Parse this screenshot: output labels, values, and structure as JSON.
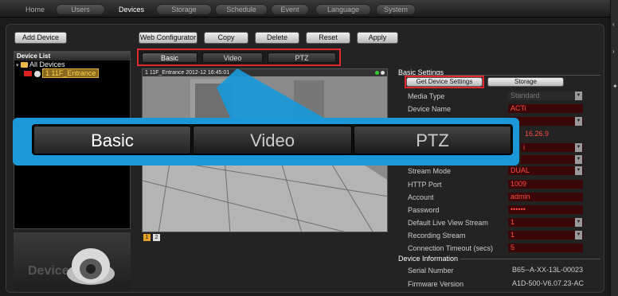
{
  "nav": {
    "tabs": [
      "Home",
      "Users",
      "Devices",
      "Storage",
      "Schedule",
      "Event",
      "Language",
      "System"
    ],
    "active": "Devices"
  },
  "toolbar": {
    "add_device": "Add Device",
    "web_configurator": "Web Configurator",
    "copy": "Copy",
    "delete": "Delete",
    "reset": "Reset",
    "apply": "Apply"
  },
  "device_list": {
    "header": "Device List",
    "root": "All Devices",
    "item": "1 11F_Entrance"
  },
  "brand": {
    "word": "Device"
  },
  "subtabs": [
    "Basic",
    "Video",
    "PTZ"
  ],
  "video": {
    "overlay": "1 11F_Entrance  2012-12 16:45:01",
    "icon_1": "1",
    "icon_2": "2"
  },
  "callout": {
    "tabs": [
      "Basic",
      "Video",
      "PTZ"
    ]
  },
  "settings": {
    "title": "Basic Settings",
    "get_device_settings": "Get Device Settings",
    "storage": "Storage",
    "rows": [
      {
        "label": "Media Type",
        "value": "Standard"
      },
      {
        "label": "Device Name",
        "value": "ACTi"
      },
      {
        "label": "Stream Mode",
        "value": "DUAL"
      },
      {
        "label": "HTTP Port",
        "value": "1009"
      },
      {
        "label": "Account",
        "value": "admin"
      },
      {
        "label": "Password",
        "value": "••••••"
      },
      {
        "label": "Default Live View Stream",
        "value": "1"
      },
      {
        "label": "Recording Stream",
        "value": "1"
      },
      {
        "label": "Connection Timeout (secs)",
        "value": "5"
      }
    ],
    "partial_values": [
      "16.26.9",
      "i"
    ],
    "device_info": {
      "title": "Device Information",
      "serial_label": "Serial Number",
      "serial_value": "B65--A-XX-13L-00023",
      "firmware_label": "Firmware Version",
      "firmware_value": "A1D-500-V6.07.23-AC"
    }
  },
  "colors": {
    "highlight": "#e0252b",
    "callout": "#1a98d8",
    "value_red": "#ff4d3d"
  }
}
